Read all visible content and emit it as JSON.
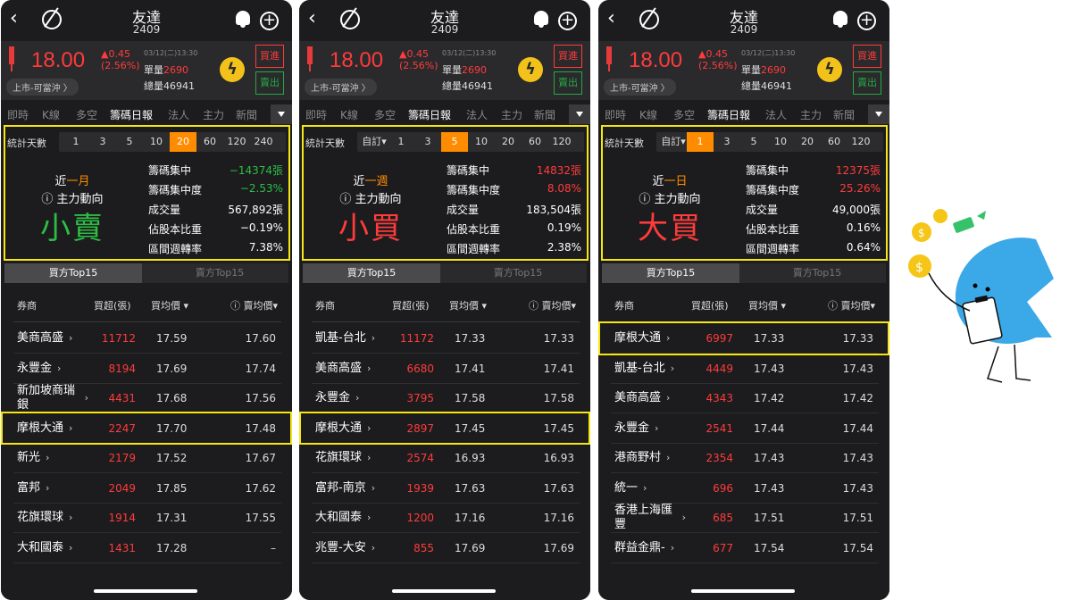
{
  "screens": [
    {
      "title": "友達",
      "code": "2409",
      "price": "18.00",
      "change": "▲0.45",
      "change_pct": "(2.56%)",
      "datetime": "03/12(二)13:30",
      "unit_vol_label": "單量",
      "unit_vol": "2690",
      "total_vol": "總量46941",
      "market": "上市-可當沖 〉",
      "buy": "買進",
      "sell": "賣出",
      "tabs": [
        "即時",
        "K線",
        "多空",
        "籌碼日報",
        "法人",
        "主力",
        "新聞"
      ],
      "active_tab": "籌碼日報",
      "days_label": "統計天數",
      "days": [
        "1",
        "3",
        "5",
        "10",
        "20",
        "60",
        "120",
        "240"
      ],
      "days_selected": "20",
      "period_prefix": "近",
      "period": "一月",
      "force_label": "ⓘ 主力動向",
      "verdict": "小賣",
      "verdict_color": "#2dbd45",
      "metrics": [
        {
          "label": "籌碼集中",
          "value": "−14374張",
          "color": "green"
        },
        {
          "label": "籌碼集中度",
          "value": "−2.53%",
          "color": "green"
        },
        {
          "label": "成交量",
          "value": "567,892張",
          "color": "white"
        },
        {
          "label": "佔股本比重",
          "value": "−0.19%",
          "color": "white"
        },
        {
          "label": "區間週轉率",
          "value": "7.38%",
          "color": "white"
        }
      ],
      "subtabs": [
        "買方Top15",
        "賣方Top15"
      ],
      "headers": [
        "券商",
        "買超(張)",
        "買均價 ▾",
        "ⓘ 賣均價▾"
      ],
      "rows": [
        {
          "broker": "美商高盛",
          "amt": "11712",
          "avg": "17.59",
          "sell": "17.60"
        },
        {
          "broker": "永豐金",
          "amt": "8194",
          "avg": "17.69",
          "sell": "17.74"
        },
        {
          "broker": "新加坡商瑞銀",
          "amt": "4431",
          "avg": "17.68",
          "sell": "17.56"
        },
        {
          "broker": "摩根大通",
          "amt": "2247",
          "avg": "17.70",
          "sell": "17.48"
        },
        {
          "broker": "新光",
          "amt": "2179",
          "avg": "17.52",
          "sell": "17.67"
        },
        {
          "broker": "富邦",
          "amt": "2049",
          "avg": "17.85",
          "sell": "17.62"
        },
        {
          "broker": "花旗環球",
          "amt": "1914",
          "avg": "17.31",
          "sell": "17.55"
        },
        {
          "broker": "大和國泰",
          "amt": "1431",
          "avg": "17.28",
          "sell": "–"
        }
      ],
      "highlight_row": 3
    },
    {
      "title": "友達",
      "code": "2409",
      "price": "18.00",
      "change": "▲0.45",
      "change_pct": "(2.56%)",
      "datetime": "03/12(二)13:30",
      "unit_vol_label": "單量",
      "unit_vol": "2690",
      "total_vol": "總量46941",
      "market": "上市-可當沖 〉",
      "buy": "買進",
      "sell": "賣出",
      "tabs": [
        "即時",
        "K線",
        "多空",
        "籌碼日報",
        "法人",
        "主力",
        "新聞"
      ],
      "active_tab": "籌碼日報",
      "days_label": "統計天數",
      "days": [
        "自訂▾",
        "1",
        "3",
        "5",
        "10",
        "20",
        "60",
        "120"
      ],
      "days_selected": "5",
      "period_prefix": "近",
      "period": "一週",
      "force_label": "ⓘ 主力動向",
      "verdict": "小買",
      "verdict_color": "#ff3b3b",
      "metrics": [
        {
          "label": "籌碼集中",
          "value": "14832張",
          "color": "red"
        },
        {
          "label": "籌碼集中度",
          "value": "8.08%",
          "color": "red"
        },
        {
          "label": "成交量",
          "value": "183,504張",
          "color": "white"
        },
        {
          "label": "佔股本比重",
          "value": "0.19%",
          "color": "white"
        },
        {
          "label": "區間週轉率",
          "value": "2.38%",
          "color": "white"
        }
      ],
      "subtabs": [
        "買方Top15",
        "賣方Top15"
      ],
      "headers": [
        "券商",
        "買超(張)",
        "買均價 ▾",
        "ⓘ 賣均價▾"
      ],
      "rows": [
        {
          "broker": "凱基-台北",
          "amt": "11172",
          "avg": "17.33",
          "sell": "17.33"
        },
        {
          "broker": "美商高盛",
          "amt": "6680",
          "avg": "17.41",
          "sell": "17.41"
        },
        {
          "broker": "永豐金",
          "amt": "3795",
          "avg": "17.58",
          "sell": "17.58"
        },
        {
          "broker": "摩根大通",
          "amt": "2897",
          "avg": "17.45",
          "sell": "17.45"
        },
        {
          "broker": "花旗環球",
          "amt": "2574",
          "avg": "16.93",
          "sell": "16.93"
        },
        {
          "broker": "富邦-南京",
          "amt": "1939",
          "avg": "17.63",
          "sell": "17.63"
        },
        {
          "broker": "大和國泰",
          "amt": "1200",
          "avg": "17.16",
          "sell": "17.16"
        },
        {
          "broker": "兆豐-大安",
          "amt": "855",
          "avg": "17.69",
          "sell": "17.69"
        }
      ],
      "highlight_row": 3
    },
    {
      "title": "友達",
      "code": "2409",
      "price": "18.00",
      "change": "▲0.45",
      "change_pct": "(2.56%)",
      "datetime": "03/12(二)13:30",
      "unit_vol_label": "單量",
      "unit_vol": "2690",
      "total_vol": "總量46941",
      "market": "上市-可當沖 〉",
      "buy": "買進",
      "sell": "賣出",
      "tabs": [
        "即時",
        "K線",
        "多空",
        "籌碼日報",
        "法人",
        "主力",
        "新聞"
      ],
      "active_tab": "籌碼日報",
      "days_label": "統計天數",
      "days": [
        "自訂▾",
        "1",
        "3",
        "5",
        "10",
        "20",
        "60",
        "120"
      ],
      "days_selected": "1",
      "period_prefix": "近",
      "period": "一日",
      "force_label": "ⓘ 主力動向",
      "verdict": "大買",
      "verdict_color": "#ff3b3b",
      "metrics": [
        {
          "label": "籌碼集中",
          "value": "12375張",
          "color": "red"
        },
        {
          "label": "籌碼集中度",
          "value": "25.26%",
          "color": "red"
        },
        {
          "label": "成交量",
          "value": "49,000張",
          "color": "white"
        },
        {
          "label": "佔股本比重",
          "value": "0.16%",
          "color": "white"
        },
        {
          "label": "區間週轉率",
          "value": "0.64%",
          "color": "white"
        }
      ],
      "subtabs": [
        "買方Top15",
        "賣方Top15"
      ],
      "headers": [
        "券商",
        "買超(張)",
        "買均價 ▾",
        "ⓘ 賣均價▾"
      ],
      "rows": [
        {
          "broker": "摩根大通",
          "amt": "6997",
          "avg": "17.33",
          "sell": "17.33"
        },
        {
          "broker": "凱基-台北",
          "amt": "4449",
          "avg": "17.43",
          "sell": "17.43"
        },
        {
          "broker": "美商高盛",
          "amt": "4343",
          "avg": "17.42",
          "sell": "17.42"
        },
        {
          "broker": "永豐金",
          "amt": "2541",
          "avg": "17.44",
          "sell": "17.44"
        },
        {
          "broker": "港商野村",
          "amt": "2354",
          "avg": "17.43",
          "sell": "17.43"
        },
        {
          "broker": "統一",
          "amt": "696",
          "avg": "17.43",
          "sell": "17.43"
        },
        {
          "broker": "香港上海匯豐",
          "amt": "685",
          "avg": "17.51",
          "sell": "17.51"
        },
        {
          "broker": "群益金鼎-",
          "amt": "677",
          "avg": "17.54",
          "sell": "17.54"
        }
      ],
      "highlight_row": 0
    }
  ],
  "colors": {
    "accent": "#ff8c00",
    "up": "#ff3b3b",
    "down": "#2dbd45",
    "highlight": "#f5e614",
    "bg": "#1c1c1e"
  },
  "icons": [
    "back-icon",
    "quick-quote-icon",
    "bell-icon",
    "add-icon",
    "bolt-icon",
    "mascot-illustration"
  ]
}
